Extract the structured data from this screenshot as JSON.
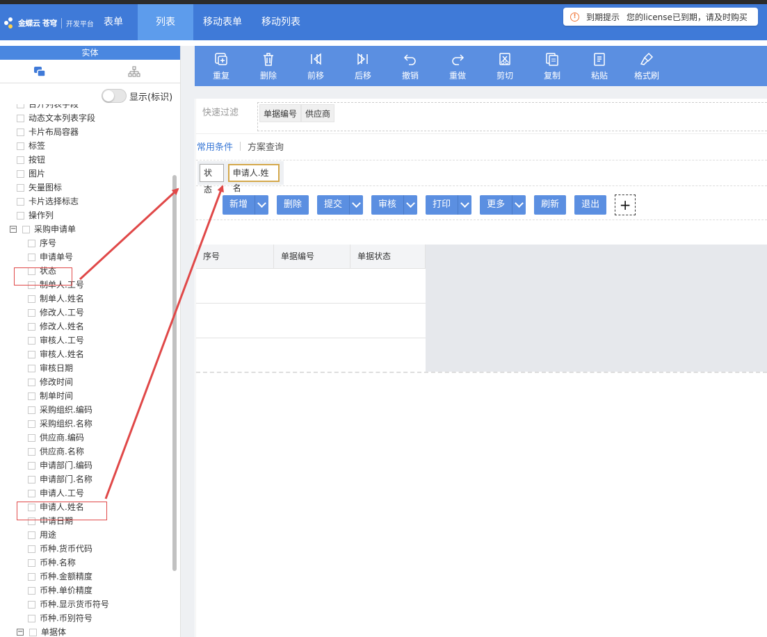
{
  "header": {
    "logo_text": "金蝶云 苍穹",
    "logo_sub": "开发平台",
    "nav": [
      {
        "label": "表单",
        "active": false
      },
      {
        "label": "列表",
        "active": true
      },
      {
        "label": "移动表单",
        "active": false
      },
      {
        "label": "移动列表",
        "active": false
      }
    ],
    "license": {
      "title": "到期提示",
      "message": "您的license已到期，请及时购买"
    }
  },
  "left_panel": {
    "title": "实体",
    "toggle_label": "显示(标识)",
    "tree": [
      {
        "label": "台开列表字段",
        "indent": 1
      },
      {
        "label": "动态文本列表字段",
        "indent": 1
      },
      {
        "label": "卡片布局容器",
        "indent": 1
      },
      {
        "label": "标签",
        "indent": 1
      },
      {
        "label": "按钮",
        "indent": 1
      },
      {
        "label": "图片",
        "indent": 1
      },
      {
        "label": "矢量图标",
        "indent": 1
      },
      {
        "label": "卡片选择标志",
        "indent": 1
      },
      {
        "label": "操作列",
        "indent": 1
      },
      {
        "label": "采购申请单",
        "indent": 0,
        "expander": "⊟"
      },
      {
        "label": "序号",
        "indent": 2
      },
      {
        "label": "申请单号",
        "indent": 2
      },
      {
        "label": "状态",
        "indent": 2
      },
      {
        "label": "制单人.工号",
        "indent": 2
      },
      {
        "label": "制单人.姓名",
        "indent": 2
      },
      {
        "label": "修改人.工号",
        "indent": 2
      },
      {
        "label": "修改人.姓名",
        "indent": 2
      },
      {
        "label": "审核人.工号",
        "indent": 2
      },
      {
        "label": "审核人.姓名",
        "indent": 2
      },
      {
        "label": "审核日期",
        "indent": 2
      },
      {
        "label": "修改时间",
        "indent": 2
      },
      {
        "label": "制单时间",
        "indent": 2
      },
      {
        "label": "采购组织.编码",
        "indent": 2
      },
      {
        "label": "采购组织.名称",
        "indent": 2
      },
      {
        "label": "供应商.编码",
        "indent": 2
      },
      {
        "label": "供应商.名称",
        "indent": 2
      },
      {
        "label": "申请部门.编码",
        "indent": 2
      },
      {
        "label": "申请部门.名称",
        "indent": 2
      },
      {
        "label": "申请人.工号",
        "indent": 2
      },
      {
        "label": "申请人.姓名",
        "indent": 2
      },
      {
        "label": "申请日期",
        "indent": 2
      },
      {
        "label": "用途",
        "indent": 2
      },
      {
        "label": "币种.货币代码",
        "indent": 2
      },
      {
        "label": "币种.名称",
        "indent": 2
      },
      {
        "label": "币种.金额精度",
        "indent": 2
      },
      {
        "label": "币种.单价精度",
        "indent": 2
      },
      {
        "label": "币种.显示货币符号",
        "indent": 2
      },
      {
        "label": "币种.币别符号",
        "indent": 2
      },
      {
        "label": "单据体",
        "indent": 1,
        "expander": "⊟"
      }
    ]
  },
  "toolbar": [
    {
      "label": "重复",
      "icon": "duplicate-icon"
    },
    {
      "label": "删除",
      "icon": "trash-icon"
    },
    {
      "label": "前移",
      "icon": "move-left-icon"
    },
    {
      "label": "后移",
      "icon": "move-right-icon"
    },
    {
      "label": "撤销",
      "icon": "undo-icon"
    },
    {
      "label": "重做",
      "icon": "redo-icon"
    },
    {
      "label": "剪切",
      "icon": "cut-icon"
    },
    {
      "label": "复制",
      "icon": "copy-icon"
    },
    {
      "label": "粘贴",
      "icon": "paste-icon"
    },
    {
      "label": "格式刷",
      "icon": "format-brush-icon"
    }
  ],
  "quick_filter": {
    "label": "快速过滤",
    "tags": [
      "单据编号",
      "供应商"
    ]
  },
  "conditions": {
    "tab_common": "常用条件",
    "tab_scheme": "方案查询",
    "chips": [
      {
        "label": "状态",
        "selected": false
      },
      {
        "label": "申请人.姓名",
        "selected": true
      }
    ]
  },
  "actions": [
    {
      "label": "新增",
      "dropdown": true
    },
    {
      "label": "删除",
      "dropdown": false
    },
    {
      "label": "提交",
      "dropdown": true
    },
    {
      "label": "审核",
      "dropdown": true
    },
    {
      "label": "打印",
      "dropdown": true
    },
    {
      "label": "更多",
      "dropdown": true
    },
    {
      "label": "刷新",
      "dropdown": false
    },
    {
      "label": "退出",
      "dropdown": false
    }
  ],
  "add_symbol": "+",
  "grid": {
    "columns": [
      "序号",
      "单据编号",
      "单据状态"
    ],
    "empty_rows": 3
  },
  "colors": {
    "header": "#3f7ad8",
    "toolbar": "#5b8fe1",
    "annotation": "#e04848"
  }
}
